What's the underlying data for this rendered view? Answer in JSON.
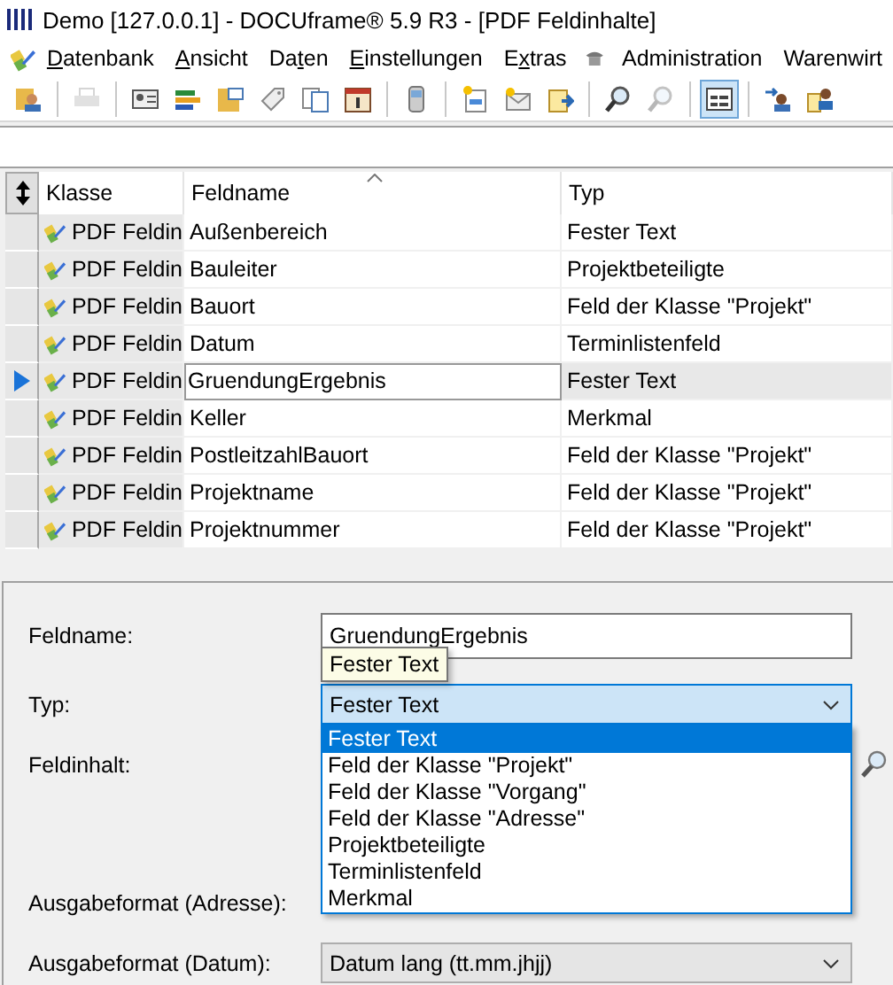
{
  "window": {
    "title": "Demo [127.0.0.1] - DOCUframe® 5.9 R3 - [PDF Feldinhalte]"
  },
  "menu": [
    {
      "kind": "text",
      "key": "D",
      "post": "atenbank"
    },
    {
      "kind": "text",
      "key": "A",
      "post": "nsicht"
    },
    {
      "kind": "text",
      "pre": "Da",
      "key": "t",
      "post": "en"
    },
    {
      "kind": "text",
      "key": "E",
      "post": "instellungen"
    },
    {
      "kind": "text",
      "pre": "E",
      "key": "x",
      "post": "tras"
    },
    {
      "kind": "icon"
    },
    {
      "kind": "text",
      "post": "Administration"
    },
    {
      "kind": "text",
      "post": "Warenwirt"
    }
  ],
  "toolbar": [
    [
      {
        "kind": "person-folder",
        "selected": false,
        "disabled": false
      }
    ],
    [
      {
        "kind": "printer",
        "selected": false,
        "disabled": true
      }
    ],
    [
      {
        "kind": "id-card",
        "selected": false,
        "disabled": false
      },
      {
        "kind": "bars",
        "selected": false,
        "disabled": false
      },
      {
        "kind": "folder",
        "selected": false,
        "disabled": false
      },
      {
        "kind": "tag",
        "selected": false,
        "disabled": false
      },
      {
        "kind": "documents",
        "selected": false,
        "disabled": false
      },
      {
        "kind": "calendar",
        "selected": false,
        "disabled": false
      }
    ],
    [
      {
        "kind": "phone",
        "selected": false,
        "disabled": false
      }
    ],
    [
      {
        "kind": "new-doc",
        "selected": false,
        "disabled": false
      },
      {
        "kind": "new-mail",
        "selected": false,
        "disabled": false
      },
      {
        "kind": "new-forward",
        "selected": false,
        "disabled": false
      }
    ],
    [
      {
        "kind": "search",
        "selected": false,
        "disabled": false
      },
      {
        "kind": "search",
        "selected": false,
        "disabled": true
      }
    ],
    [
      {
        "kind": "window",
        "selected": true,
        "disabled": false
      }
    ],
    [
      {
        "kind": "people-arrow",
        "selected": false,
        "disabled": false
      },
      {
        "kind": "people-doc",
        "selected": false,
        "disabled": false
      }
    ]
  ],
  "table": {
    "columns": [
      "Klasse",
      "Feldname",
      "Typ"
    ],
    "rows": [
      {
        "klasse": "PDF Feldin",
        "feldname": "Außenbereich",
        "typ": "Fester Text",
        "selected": false
      },
      {
        "klasse": "PDF Feldin",
        "feldname": "Bauleiter",
        "typ": "Projektbeteiligte",
        "selected": false
      },
      {
        "klasse": "PDF Feldin",
        "feldname": "Bauort",
        "typ": "Feld der Klasse \"Projekt\"",
        "selected": false
      },
      {
        "klasse": "PDF Feldin",
        "feldname": "Datum",
        "typ": "Terminlistenfeld",
        "selected": false
      },
      {
        "klasse": "PDF Feldin",
        "feldname": "GruendungErgebnis",
        "typ": "Fester Text",
        "selected": true
      },
      {
        "klasse": "PDF Feldin",
        "feldname": "Keller",
        "typ": "Merkmal",
        "selected": false
      },
      {
        "klasse": "PDF Feldin",
        "feldname": "PostleitzahlBauort",
        "typ": "Feld der Klasse \"Projekt\"",
        "selected": false
      },
      {
        "klasse": "PDF Feldin",
        "feldname": "Projektname",
        "typ": "Feld der Klasse \"Projekt\"",
        "selected": false
      },
      {
        "klasse": "PDF Feldin",
        "feldname": "Projektnummer",
        "typ": "Feld der Klasse \"Projekt\"",
        "selected": false
      }
    ]
  },
  "form": {
    "feldname": {
      "label": "Feldname:",
      "value": "GruendungErgebnis"
    },
    "tooltip": "Fester Text",
    "typ": {
      "label": "Typ:",
      "value": "Fester Text",
      "expanded": true,
      "options": [
        {
          "label": "Fester Text",
          "selected": true
        },
        {
          "label": "Feld der Klasse \"Projekt\"",
          "selected": false
        },
        {
          "label": "Feld der Klasse \"Vorgang\"",
          "selected": false
        },
        {
          "label": "Feld der Klasse \"Adresse\"",
          "selected": false
        },
        {
          "label": "Projektbeteiligte",
          "selected": false
        },
        {
          "label": "Terminlistenfeld",
          "selected": false
        },
        {
          "label": "Merkmal",
          "selected": false
        }
      ]
    },
    "feldinhalt": {
      "label": "Feldinhalt:"
    },
    "ausgabe_adresse": {
      "label": "Ausgabeformat (Adresse):"
    },
    "ausgabe_datum": {
      "label": "Ausgabeformat (Datum):",
      "value": "Datum lang (tt.mm.jhjj)"
    }
  }
}
